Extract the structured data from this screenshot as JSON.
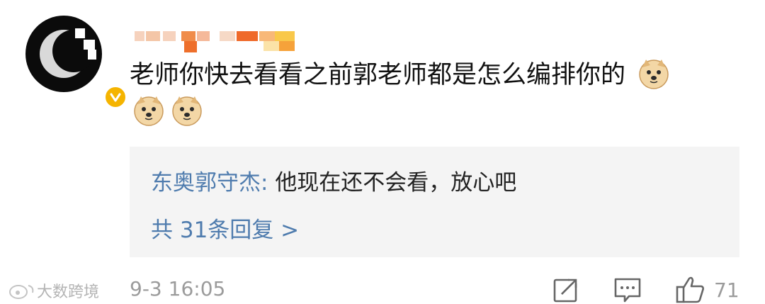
{
  "comment": {
    "text": "老师你快去看看之前郭老师都是怎么编排你的"
  },
  "reply": {
    "author": "东奥郭守杰:",
    "text": "他现在还不会看，放心吧",
    "count_link": "共 31条回复 >"
  },
  "footer": {
    "watermark": "大数跨境",
    "timestamp": "9-3 16:05",
    "like_count": "71"
  },
  "icons": {
    "verified": "verified-badge-icon",
    "emoji": "doge-emoji-icon",
    "repost": "share-icon",
    "comment": "comment-icon",
    "like": "thumbs-up-icon"
  },
  "colors": {
    "link": "#4f7cae",
    "badge": "#f5b400",
    "reply_bg": "#f4f4f4"
  }
}
